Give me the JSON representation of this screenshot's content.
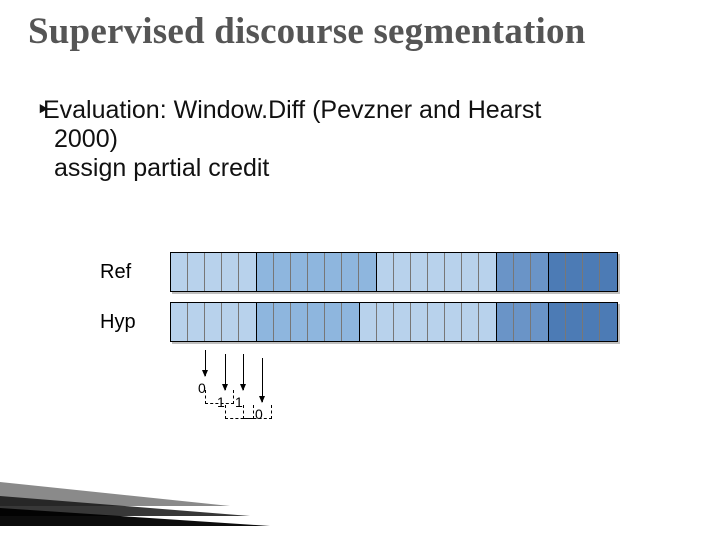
{
  "title": "Supervised discourse segmentation",
  "bullet_marker": "‣",
  "bullet_line1": "Evaluation: Window.Diff (Pevzner and Hearst",
  "bullet_line2": "2000)",
  "bullet_line3": "assign partial credit",
  "labels": {
    "ref": "Ref",
    "hyp": "Hyp"
  },
  "ref_segments": [
    {
      "color": "c-lb",
      "cells": 5
    },
    {
      "color": "c-mb",
      "cells": 7
    },
    {
      "color": "c-lb",
      "cells": 7
    },
    {
      "color": "c-db",
      "cells": 3
    },
    {
      "color": "c-xb",
      "cells": 4
    }
  ],
  "hyp_segments": [
    {
      "color": "c-lb",
      "cells": 5
    },
    {
      "color": "c-mb",
      "cells": 6
    },
    {
      "color": "c-lb",
      "cells": 8
    },
    {
      "color": "c-db",
      "cells": 3
    },
    {
      "color": "c-xb",
      "cells": 4
    }
  ],
  "anno_numbers": [
    "0",
    "1",
    "1",
    "0"
  ]
}
